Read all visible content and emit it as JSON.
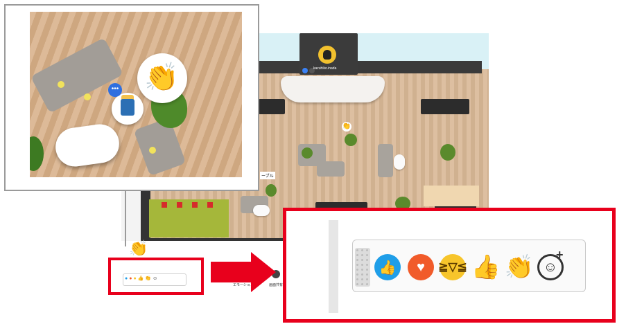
{
  "avatar_card": {
    "name": "kazuhiko.inada"
  },
  "office": {
    "table_label": "ーブル",
    "toolbar_labels": [
      "エモーション",
      "画面共有"
    ]
  },
  "reactions": {
    "icons": [
      "thumbs-up-circle-icon",
      "heart-circle-icon",
      "laughing-face-icon",
      "thumbs-up-icon",
      "clapping-hands-icon",
      "add-reaction-icon"
    ],
    "thumb_blue_glyph": "👍",
    "heart_glyph": "♥",
    "laugh_glyph": "≧▽≦",
    "thumb_glyph": "👍",
    "clap_glyph": "👏",
    "add_glyph": "☺",
    "add_plus": "+"
  },
  "zoom": {
    "more_glyph": "•••",
    "clap_glyph": "👏"
  },
  "colors": {
    "highlight": "#e8001c",
    "reaction_blue": "#1f9ee8",
    "reaction_orange": "#f15b2a",
    "reaction_yellow": "#f7c52b"
  }
}
